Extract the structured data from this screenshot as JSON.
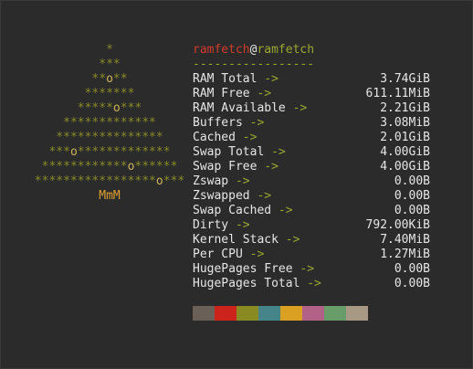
{
  "art": {
    "lines": [
      "*",
      "***",
      "**o**",
      "*******",
      "*****o***",
      "*************",
      "***************",
      "***o*************",
      "************o******",
      "*****************o***"
    ],
    "trunk": "MmM"
  },
  "header": {
    "user": "ramfetch",
    "at": "@",
    "host": "ramfetch",
    "separator": "-----------------"
  },
  "rows": [
    {
      "label": "RAM Total",
      "arrow": " ->",
      "value": "3.74GiB"
    },
    {
      "label": "RAM Free",
      "arrow": " ->",
      "value": "611.11MiB"
    },
    {
      "label": "RAM Available",
      "arrow": " ->",
      "value": "2.21GiB"
    },
    {
      "label": "Buffers",
      "arrow": " ->",
      "value": "3.08MiB"
    },
    {
      "label": "Cached",
      "arrow": " ->",
      "value": "2.01GiB"
    },
    {
      "label": "Swap Total",
      "arrow": " ->",
      "value": "4.00GiB"
    },
    {
      "label": "Swap Free",
      "arrow": " ->",
      "value": "4.00GiB"
    },
    {
      "label": "Zswap",
      "arrow": " ->",
      "value": "0.00B"
    },
    {
      "label": "Zswapped",
      "arrow": " ->",
      "value": "0.00B"
    },
    {
      "label": "Swap Cached",
      "arrow": " ->",
      "value": "0.00B"
    },
    {
      "label": "Dirty",
      "arrow": " ->",
      "value": "792.00KiB"
    },
    {
      "label": "Kernel Stack",
      "arrow": " ->",
      "value": "7.40MiB"
    },
    {
      "label": "Per CPU",
      "arrow": " ->",
      "value": "1.27MiB"
    },
    {
      "label": "HugePages Free",
      "arrow": " ->",
      "value": "0.00B"
    },
    {
      "label": "HugePages Total",
      "arrow": " ->",
      "value": "0.00B"
    }
  ],
  "palette": [
    "#6b6058",
    "#cc241d",
    "#898a22",
    "#45858a",
    "#d9a021",
    "#b16286",
    "#689d6a",
    "#a89984"
  ]
}
